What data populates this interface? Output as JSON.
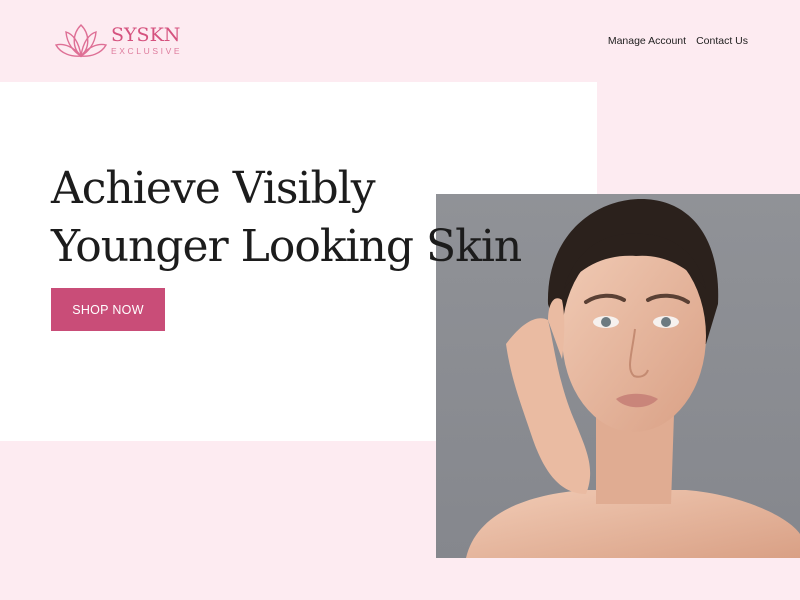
{
  "brand": {
    "name": "SYSKN",
    "tagline": "EXCLUSIVE",
    "icon": "lotus-icon",
    "color": "#d5527e"
  },
  "nav": {
    "items": [
      {
        "label": "Manage Account"
      },
      {
        "label": "Contact Us"
      }
    ]
  },
  "hero": {
    "headline_line1": "Achieve Visibly",
    "headline_line2": "Younger Looking Skin",
    "cta_label": "SHOP NOW",
    "cta_color": "#c94d78"
  },
  "colors": {
    "background": "#fdebf1",
    "panel": "#ffffff",
    "photo_backdrop": "#8e9096"
  }
}
